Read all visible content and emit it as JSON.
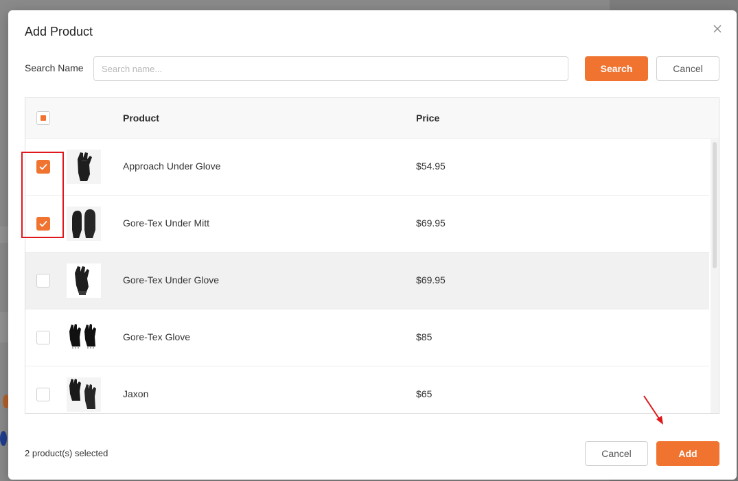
{
  "modal": {
    "title": "Add Product",
    "search_label": "Search Name",
    "search_placeholder": "Search name...",
    "search_value": "",
    "search_button": "Search",
    "cancel_top_button": "Cancel",
    "selected_count_text": "2 product(s) selected",
    "cancel_button": "Cancel",
    "add_button": "Add"
  },
  "table": {
    "headers": {
      "product": "Product",
      "price": "Price"
    },
    "select_all_state": "indeterminate",
    "rows": [
      {
        "name": "Approach Under Glove",
        "price": "$54.95",
        "checked": true,
        "thumb": "single-glove"
      },
      {
        "name": "Gore-Tex Under Mitt",
        "price": "$69.95",
        "checked": true,
        "thumb": "mitt"
      },
      {
        "name": "Gore-Tex Under Glove",
        "price": "$69.95",
        "checked": false,
        "thumb": "single-glove"
      },
      {
        "name": "Gore-Tex Glove",
        "price": "$85",
        "checked": false,
        "thumb": "glove-pair"
      },
      {
        "name": "Jaxon",
        "price": "$65",
        "checked": false,
        "thumb": "glove-pair-offset"
      }
    ]
  },
  "colors": {
    "accent": "#f07330",
    "annotation": "#e0171b"
  },
  "icons": {
    "close": "close-icon",
    "check": "checkmark-icon",
    "annotation_arrow": "arrow-icon"
  }
}
